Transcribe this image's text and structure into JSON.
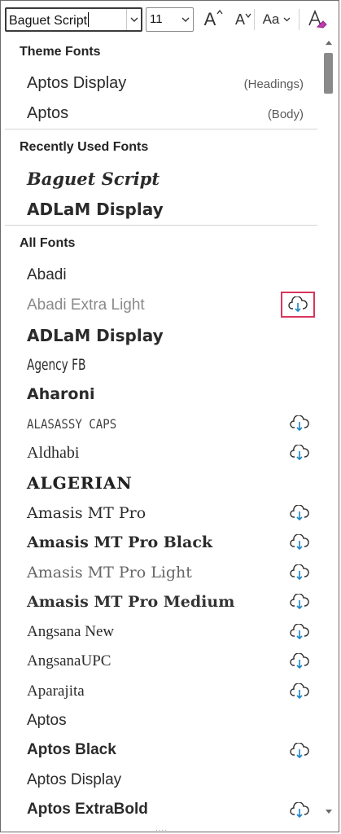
{
  "toolbar": {
    "font_name_value": "Baguet Script",
    "font_size_value": "11",
    "grow_font_label": "A",
    "shrink_font_label": "A",
    "change_case_label": "Aa"
  },
  "sections": {
    "theme_fonts": "Theme Fonts",
    "recently_used": "Recently Used Fonts",
    "all_fonts": "All Fonts"
  },
  "theme_fonts": [
    {
      "name": "Aptos Display",
      "tag": "(Headings)"
    },
    {
      "name": "Aptos",
      "tag": "(Body)"
    }
  ],
  "recent_fonts": [
    {
      "name": "Baguet Script"
    },
    {
      "name": "ADLaM Display"
    }
  ],
  "all_fonts": [
    {
      "name": "Abadi",
      "cloud": false
    },
    {
      "name": "Abadi Extra Light",
      "cloud": true,
      "focused": true
    },
    {
      "name": "ADLaM Display",
      "cloud": false
    },
    {
      "name": "Agency FB",
      "cloud": false
    },
    {
      "name": "Aharoni",
      "cloud": false
    },
    {
      "name": "ALASASSY CAPS",
      "cloud": true
    },
    {
      "name": "Aldhabi",
      "cloud": true
    },
    {
      "name": "ALGERIAN",
      "cloud": false
    },
    {
      "name": "Amasis MT Pro",
      "cloud": true
    },
    {
      "name": "Amasis MT Pro Black",
      "cloud": true
    },
    {
      "name": "Amasis MT Pro Light",
      "cloud": true
    },
    {
      "name": "Amasis MT Pro Medium",
      "cloud": true
    },
    {
      "name": "Angsana New",
      "cloud": true
    },
    {
      "name": "AngsanaUPC",
      "cloud": true
    },
    {
      "name": "Aparajita",
      "cloud": true
    },
    {
      "name": "Aptos",
      "cloud": false
    },
    {
      "name": "Aptos Black",
      "cloud": true
    },
    {
      "name": "Aptos Display",
      "cloud": false
    },
    {
      "name": "Aptos ExtraBold",
      "cloud": true
    }
  ],
  "colors": {
    "focus_outline": "#d8355d",
    "cloud_icon": "#2b2b2b",
    "cloud_arrow": "#1a86c9"
  },
  "grip": "....",
  "icons": [
    "chevron-down-icon",
    "grow-font-icon",
    "shrink-font-icon",
    "change-case-icon",
    "clear-formatting-icon",
    "cloud-download-icon",
    "scroll-up-icon",
    "scroll-down-icon"
  ]
}
